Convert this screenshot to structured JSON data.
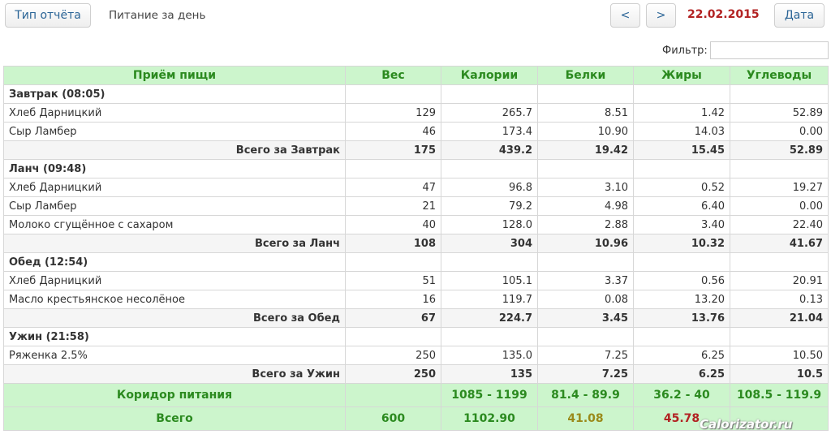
{
  "header": {
    "report_type_label": "Тип отчёта",
    "title": "Питание за день",
    "prev_label": "<",
    "next_label": ">",
    "date": "22.02.2015",
    "date_button_label": "Дата"
  },
  "filter": {
    "label": "Фильтр:",
    "value": ""
  },
  "columns": [
    "Приём пищи",
    "Вес",
    "Калории",
    "Белки",
    "Жиры",
    "Углеводы"
  ],
  "meals": [
    {
      "title": "Завтрак (08:05)",
      "items": [
        [
          "Хлеб Дарницкий",
          "129",
          "265.7",
          "8.51",
          "1.42",
          "52.89"
        ],
        [
          "Сыр Ламбер",
          "46",
          "173.4",
          "10.90",
          "14.03",
          "0.00"
        ]
      ],
      "total": [
        "Всего за Завтрак",
        "175",
        "439.2",
        "19.42",
        "15.45",
        "52.89"
      ]
    },
    {
      "title": "Ланч (09:48)",
      "items": [
        [
          "Хлеб Дарницкий",
          "47",
          "96.8",
          "3.10",
          "0.52",
          "19.27"
        ],
        [
          "Сыр Ламбер",
          "21",
          "79.2",
          "4.98",
          "6.40",
          "0.00"
        ],
        [
          "Молоко сгущённое с сахаром",
          "40",
          "128.0",
          "2.88",
          "3.40",
          "22.40"
        ]
      ],
      "total": [
        "Всего за Ланч",
        "108",
        "304",
        "10.96",
        "10.32",
        "41.67"
      ]
    },
    {
      "title": "Обед (12:54)",
      "items": [
        [
          "Хлеб Дарницкий",
          "51",
          "105.1",
          "3.37",
          "0.56",
          "20.91"
        ],
        [
          "Масло крестьянское несолёное",
          "16",
          "119.7",
          "0.08",
          "13.20",
          "0.13"
        ]
      ],
      "total": [
        "Всего за Обед",
        "67",
        "224.7",
        "3.45",
        "13.76",
        "21.04"
      ]
    },
    {
      "title": "Ужин (21:58)",
      "items": [
        [
          "Ряженка 2.5%",
          "250",
          "135.0",
          "7.25",
          "6.25",
          "10.50"
        ]
      ],
      "total": [
        "Всего за Ужин",
        "250",
        "135",
        "7.25",
        "6.25",
        "10.5"
      ]
    }
  ],
  "corridor": [
    "Коридор питания",
    "",
    "1085 - 1199",
    "81.4 - 89.9",
    "36.2 - 40",
    "108.5 - 119.9"
  ],
  "grand_total": [
    "Всего",
    "600",
    "1102.90",
    "41.08",
    "45.78",
    ""
  ],
  "colors": {
    "header_bg": "#ccf5cc",
    "header_text": "#2b8a1f",
    "date_text": "#b22222",
    "protein_total": "#9a8a1a",
    "fat_total": "#b22222"
  },
  "watermark": "Calorizator.ru"
}
